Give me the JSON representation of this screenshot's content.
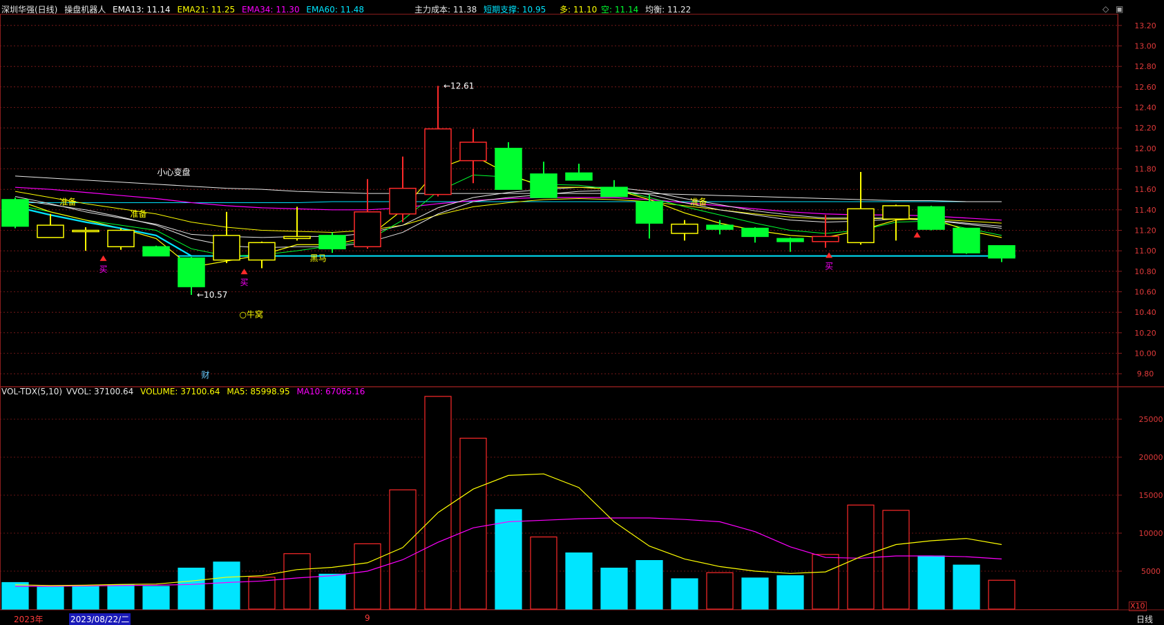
{
  "header": {
    "stock": "深圳华强(日线)",
    "indicator": "操盘机器人",
    "ema13": "EMA13: 11.14",
    "ema21": "EMA21: 11.25",
    "ema34": "EMA34: 11.30",
    "ema60": "EMA60: 11.48",
    "main_cost": "主力成本: 11.38",
    "short_support": "短期支撑: 10.95",
    "bull": "多: 11.10",
    "bear": "空: 11.14",
    "balance": "均衡: 11.22"
  },
  "vol_header": {
    "name": "VOL-TDX(5,10)",
    "vvol": "VVOL: 37100.64",
    "volume": "VOLUME: 37100.64",
    "ma5": "MA5: 85998.95",
    "ma10": "MA10: 67065.16"
  },
  "controls": {
    "diamond": "◇",
    "window": "▣"
  },
  "bottom": {
    "year": "2023年",
    "date": "2023/08/22/二",
    "month": "9",
    "period": "日线",
    "unit": "X10"
  },
  "colors": {
    "up": "#ff2a2a",
    "down": "#00ff30",
    "cyan": "#00e5ff",
    "yellow": "#ffff00",
    "magenta": "#ff00ff",
    "white": "#e8e8e8",
    "grid": "#8b1d1d"
  },
  "chart_data": [
    {
      "type": "candlestick",
      "title": "深圳华强(日线)",
      "ylim": [
        9.7,
        13.3
      ],
      "y_ticks": [
        9.8,
        10.0,
        10.2,
        10.4,
        10.6,
        10.8,
        11.0,
        11.2,
        11.4,
        11.6,
        11.8,
        12.0,
        12.2,
        12.4,
        12.6,
        12.8,
        13.0,
        13.2
      ],
      "candles": [
        {
          "o": 11.5,
          "c": 11.24,
          "h": 11.52,
          "l": 11.22,
          "color": "green"
        },
        {
          "o": 11.13,
          "c": 11.25,
          "h": 11.36,
          "l": 11.13,
          "color": "yellow"
        },
        {
          "o": 11.19,
          "c": 11.2,
          "h": 11.23,
          "l": 11.0,
          "color": "yellow"
        },
        {
          "o": 11.04,
          "c": 11.2,
          "h": 11.22,
          "l": 11.01,
          "color": "yellow"
        },
        {
          "o": 11.04,
          "c": 10.95,
          "h": 11.05,
          "l": 10.95,
          "color": "green"
        },
        {
          "o": 10.93,
          "c": 10.65,
          "h": 10.94,
          "l": 10.57,
          "color": "green"
        },
        {
          "o": 10.91,
          "c": 11.15,
          "h": 11.38,
          "l": 10.88,
          "color": "yellow"
        },
        {
          "o": 10.91,
          "c": 11.08,
          "h": 11.09,
          "l": 10.83,
          "color": "yellow"
        },
        {
          "o": 11.12,
          "c": 11.14,
          "h": 11.43,
          "l": 11.1,
          "color": "yellow"
        },
        {
          "o": 11.15,
          "c": 11.02,
          "h": 11.18,
          "l": 10.98,
          "color": "green"
        },
        {
          "o": 11.04,
          "c": 11.38,
          "h": 11.7,
          "l": 11.02,
          "color": "red"
        },
        {
          "o": 11.36,
          "c": 11.61,
          "h": 11.92,
          "l": 11.28,
          "color": "red"
        },
        {
          "o": 11.55,
          "c": 12.19,
          "h": 12.61,
          "l": 11.53,
          "color": "red"
        },
        {
          "o": 11.88,
          "c": 12.06,
          "h": 12.19,
          "l": 11.66,
          "color": "red"
        },
        {
          "o": 12.0,
          "c": 11.6,
          "h": 12.06,
          "l": 11.6,
          "color": "green"
        },
        {
          "o": 11.75,
          "c": 11.52,
          "h": 11.87,
          "l": 11.52,
          "color": "green"
        },
        {
          "o": 11.76,
          "c": 11.69,
          "h": 11.85,
          "l": 11.69,
          "color": "green"
        },
        {
          "o": 11.62,
          "c": 11.53,
          "h": 11.69,
          "l": 11.53,
          "color": "green"
        },
        {
          "o": 11.48,
          "c": 11.27,
          "h": 11.55,
          "l": 11.12,
          "color": "green"
        },
        {
          "o": 11.17,
          "c": 11.26,
          "h": 11.3,
          "l": 11.1,
          "color": "yellow"
        },
        {
          "o": 11.25,
          "c": 11.21,
          "h": 11.3,
          "l": 11.16,
          "color": "green"
        },
        {
          "o": 11.22,
          "c": 11.14,
          "h": 11.23,
          "l": 11.08,
          "color": "green"
        },
        {
          "o": 11.12,
          "c": 11.09,
          "h": 11.13,
          "l": 10.99,
          "color": "green"
        },
        {
          "o": 11.09,
          "c": 11.14,
          "h": 11.35,
          "l": 11.03,
          "color": "red"
        },
        {
          "o": 11.08,
          "c": 11.41,
          "h": 11.77,
          "l": 11.06,
          "color": "yellow"
        },
        {
          "o": 11.31,
          "c": 11.44,
          "h": 11.45,
          "l": 11.1,
          "color": "yellow"
        },
        {
          "o": 11.43,
          "c": 11.21,
          "h": 11.44,
          "l": 11.2,
          "color": "green"
        },
        {
          "o": 11.22,
          "c": 10.98,
          "h": 11.22,
          "l": 10.97,
          "color": "green"
        },
        {
          "o": 11.05,
          "c": 10.93,
          "h": 11.05,
          "l": 10.89,
          "color": "green"
        }
      ],
      "lines": {
        "yellow": [
          11.5,
          11.38,
          11.3,
          11.22,
          11.12,
          10.84,
          10.9,
          10.96,
          11.06,
          11.06,
          11.13,
          11.4,
          11.8,
          11.93,
          11.75,
          11.62,
          11.62,
          11.6,
          11.5,
          11.37,
          11.27,
          11.2,
          11.15,
          11.13,
          11.2,
          11.3,
          11.32,
          11.2,
          11.13
        ],
        "green": [
          11.45,
          11.38,
          11.3,
          11.25,
          11.2,
          11.02,
          10.95,
          10.96,
          11.0,
          11.05,
          11.1,
          11.3,
          11.58,
          11.74,
          11.72,
          11.65,
          11.64,
          11.6,
          11.52,
          11.43,
          11.35,
          11.27,
          11.2,
          11.17,
          11.2,
          11.28,
          11.29,
          11.22,
          11.15
        ],
        "white1": [
          11.53,
          11.46,
          11.38,
          11.32,
          11.26,
          11.16,
          11.14,
          11.13,
          11.14,
          11.14,
          11.17,
          11.25,
          11.42,
          11.52,
          11.57,
          11.6,
          11.62,
          11.62,
          11.58,
          11.51,
          11.45,
          11.39,
          11.35,
          11.32,
          11.32,
          11.32,
          11.3,
          11.27,
          11.24
        ],
        "white2": [
          11.5,
          11.45,
          11.4,
          11.33,
          11.25,
          11.12,
          11.05,
          11.03,
          11.04,
          11.04,
          11.08,
          11.18,
          11.36,
          11.48,
          11.52,
          11.55,
          11.58,
          11.59,
          11.55,
          11.47,
          11.4,
          11.35,
          11.3,
          11.28,
          11.29,
          11.31,
          11.3,
          11.26,
          11.22
        ],
        "yellow_slow": [
          11.58,
          11.52,
          11.46,
          11.41,
          11.36,
          11.28,
          11.23,
          11.2,
          11.19,
          11.18,
          11.2,
          11.25,
          11.35,
          11.43,
          11.47,
          11.5,
          11.51,
          11.5,
          11.48,
          11.44,
          11.4,
          11.36,
          11.33,
          11.31,
          11.31,
          11.32,
          11.31,
          11.29,
          11.27
        ],
        "magenta": [
          11.62,
          11.6,
          11.57,
          11.54,
          11.51,
          11.47,
          11.44,
          11.42,
          11.41,
          11.4,
          11.4,
          11.42,
          11.46,
          11.49,
          11.51,
          11.52,
          11.52,
          11.52,
          11.5,
          11.47,
          11.44,
          11.41,
          11.38,
          11.36,
          11.35,
          11.35,
          11.34,
          11.32,
          11.3
        ],
        "white3": [
          11.73,
          11.71,
          11.69,
          11.67,
          11.65,
          11.63,
          11.61,
          11.6,
          11.58,
          11.57,
          11.56,
          11.56,
          11.56,
          11.56,
          11.56,
          11.56,
          11.56,
          11.56,
          11.56,
          11.55,
          11.54,
          11.53,
          11.52,
          11.51,
          11.5,
          11.49,
          11.49,
          11.48,
          11.48
        ],
        "cyan_main": [
          11.47,
          11.47,
          11.47,
          11.47,
          11.47,
          11.47,
          11.47,
          11.47,
          11.47,
          11.48,
          11.48,
          11.48,
          11.48,
          11.48,
          11.48,
          11.48,
          11.48,
          11.48,
          11.48,
          11.48,
          11.48,
          11.48,
          11.48,
          11.48,
          11.48,
          11.48,
          11.48,
          11.48,
          11.48
        ],
        "cyan_decline": [
          11.43,
          11.35,
          11.28,
          11.22,
          11.15,
          10.95
        ]
      },
      "support": 10.95,
      "labels": [
        {
          "text": "12.61",
          "i": 12,
          "y": 12.61
        },
        {
          "text": "10.57",
          "i": 5,
          "y": 10.57
        },
        {
          "text": "小心变盘",
          "i": 4.5,
          "y": 11.74
        },
        {
          "text": "准备",
          "i": 1.5,
          "y": 11.45
        },
        {
          "text": "准备",
          "i": 3.5,
          "y": 11.33
        },
        {
          "text": "准备",
          "i": 19.4,
          "y": 11.45
        },
        {
          "text": "黑马",
          "i": 8.6,
          "y": 10.9
        },
        {
          "text": "买",
          "i": 2.5,
          "y": 10.82
        },
        {
          "text": "买",
          "i": 6.5,
          "y": 10.69
        },
        {
          "text": "买",
          "i": 23.1,
          "y": 10.85
        },
        {
          "text": "牛窝",
          "i": 6.7,
          "y": 10.35
        },
        {
          "text": "财",
          "i": 5.4,
          "y": 9.76
        }
      ]
    },
    {
      "type": "bar",
      "title": "VOL-TDX(5,10)",
      "ylim": [
        0,
        28000
      ],
      "y_ticks": [
        5000,
        10000,
        15000,
        20000,
        25000
      ],
      "volume": [
        3500,
        3000,
        3000,
        3200,
        3000,
        5400,
        6200,
        4200,
        7300,
        4600,
        8600,
        15700,
        28000,
        22500,
        13100,
        9500,
        7400,
        5400,
        6400,
        4000,
        4800,
        4100,
        4400,
        7200,
        13700,
        13000,
        7000,
        5800,
        3800
      ],
      "vol_colors": [
        "cyan",
        "cyan",
        "cyan",
        "cyan",
        "cyan",
        "cyan",
        "cyan",
        "red",
        "red",
        "cyan",
        "red",
        "red",
        "red",
        "red",
        "cyan",
        "red",
        "cyan",
        "cyan",
        "cyan",
        "cyan",
        "red",
        "cyan",
        "cyan",
        "red",
        "red",
        "red",
        "cyan",
        "cyan",
        "red"
      ],
      "ma5": [
        3200,
        3100,
        3150,
        3250,
        3300,
        3700,
        4200,
        4400,
        5200,
        5500,
        6100,
        8100,
        12700,
        15800,
        17600,
        17800,
        16000,
        11500,
        8300,
        6600,
        5600,
        5000,
        4700,
        4900,
        6900,
        8500,
        9000,
        9300,
        8500
      ],
      "ma10": [
        3000,
        3000,
        3050,
        3100,
        3150,
        3250,
        3500,
        3700,
        4100,
        4400,
        5000,
        6500,
        8800,
        10700,
        11500,
        11700,
        11900,
        12000,
        12000,
        11800,
        11500,
        10200,
        8200,
        6800,
        6700,
        7000,
        7000,
        6900,
        6600
      ]
    }
  ]
}
